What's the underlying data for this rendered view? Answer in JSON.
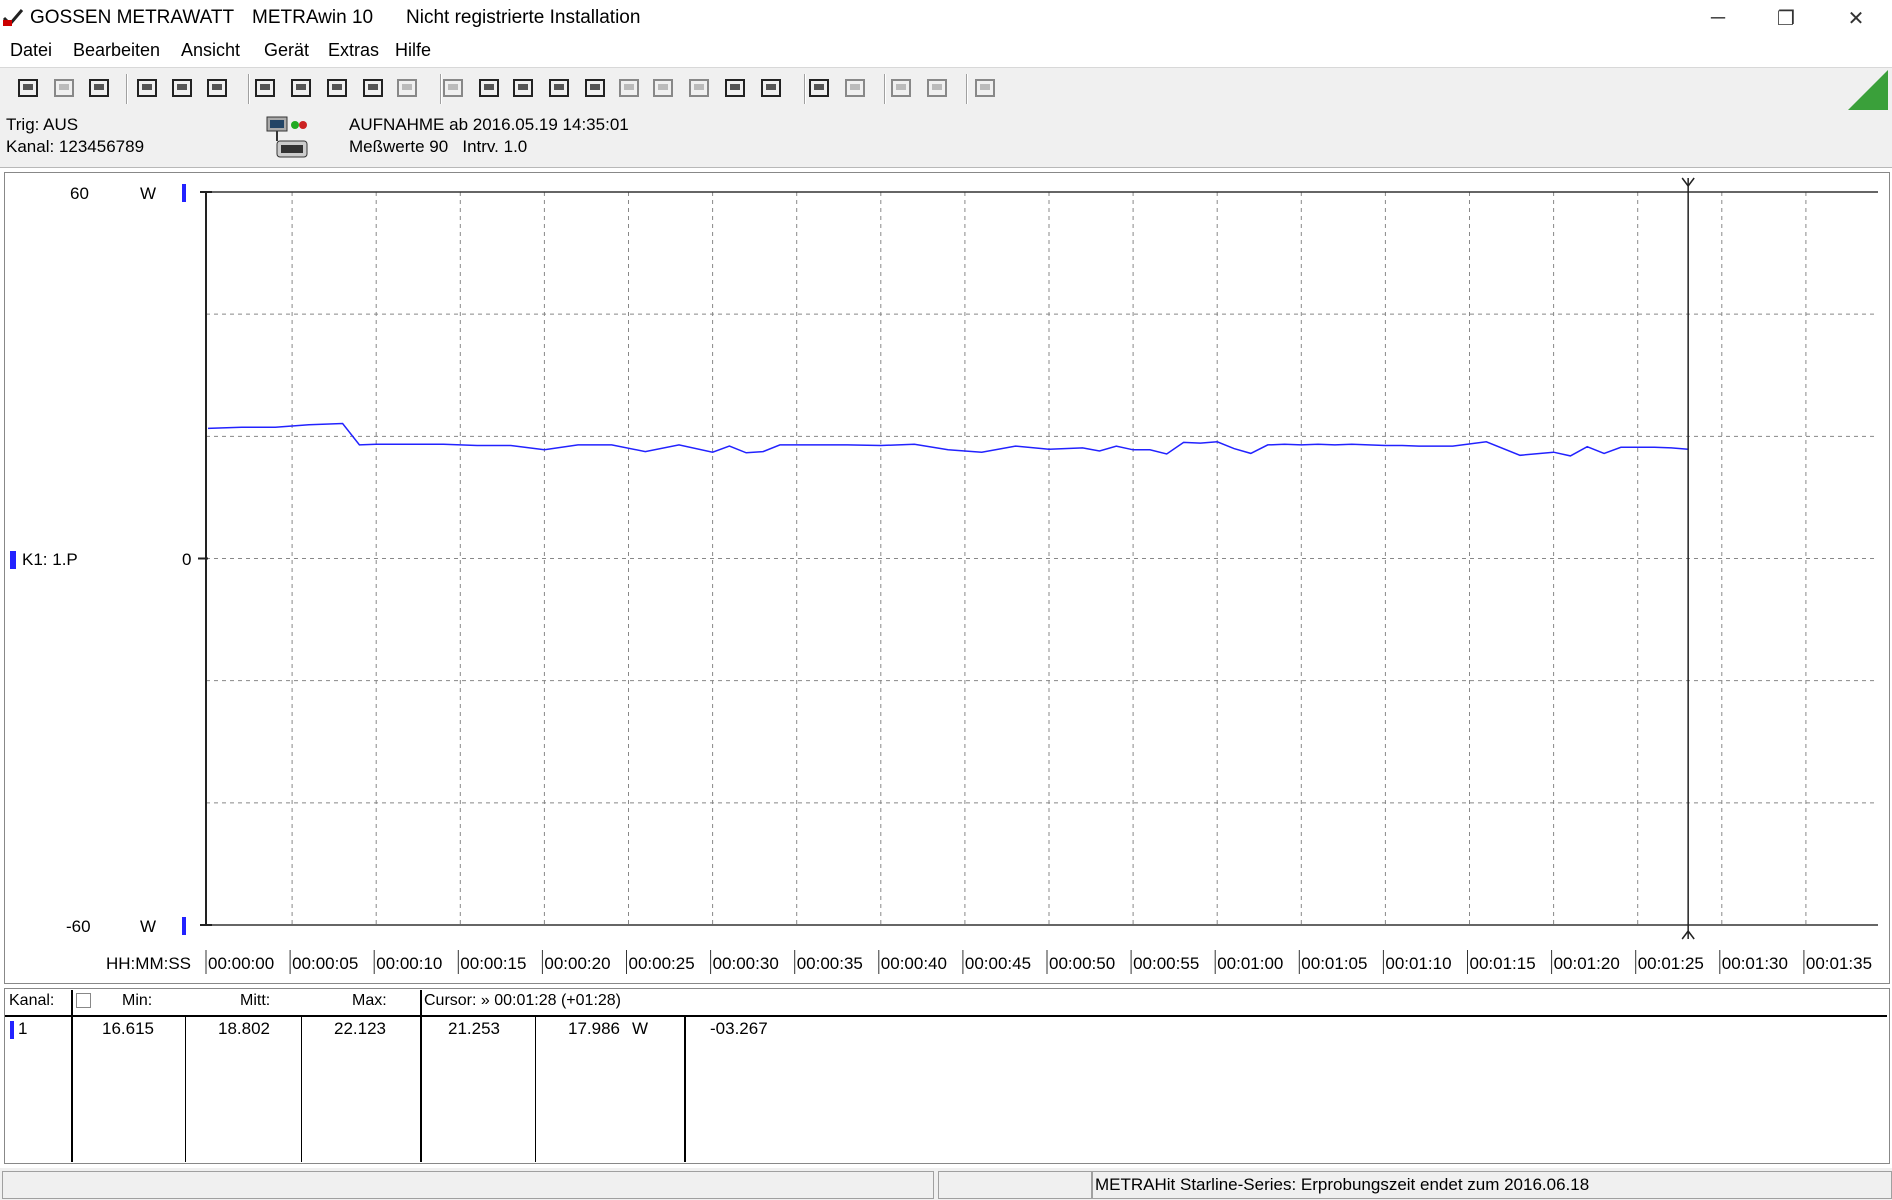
{
  "window": {
    "brand": "GOSSEN METRAWATT",
    "app": "METRAwin 10",
    "subtitle": "Nicht registrierte Installation",
    "minimize": "─",
    "restore": "❐",
    "close": "✕"
  },
  "menu": [
    "Datei",
    "Bearbeiten",
    "Ansicht",
    "Gerät",
    "Extras",
    "Hilfe"
  ],
  "toolbar": {
    "icons": [
      "save-icon",
      "save-disabled-icon",
      "open-icon",
      "device-read-icon",
      "device-record-icon",
      "device-stop-icon",
      "display-icon",
      "scope-icon",
      "cursor-icon",
      "table-icon",
      "bars-icon",
      "export-icon",
      "print-preview-icon",
      "settings-icon",
      "monitor-icon",
      "formula-icon",
      "calc-icon",
      "wave-icon",
      "wave2-icon",
      "find-icon",
      "clock-icon",
      "print-icon",
      "print2-icon",
      "zoom-in-icon",
      "zoom-out-icon",
      "comment-icon"
    ],
    "accent": "#3aa03a"
  },
  "info": {
    "trig": "Trig: AUS",
    "kanal": "Kanal: 123456789",
    "aufnahme": "AUFNAHME ab 2016.05.19 14:35:01",
    "messwerte": "Meßwerte 90   Intrv. 1.0"
  },
  "chart_data": {
    "type": "line",
    "y_top_label": "60",
    "y_bottom_label": "-60",
    "y_unit": "W",
    "y_zero_label": "0",
    "ylim": [
      -60,
      60
    ],
    "channel_label": "K1: 1.P",
    "x_axis_label": "HH:MM:SS",
    "x_ticks": [
      "00:00:00",
      "00:00:05",
      "00:00:10",
      "00:00:15",
      "00:00:20",
      "00:00:25",
      "00:00:30",
      "00:00:35",
      "00:00:40",
      "00:00:45",
      "00:00:50",
      "00:00:55",
      "00:01:00",
      "00:01:05",
      "00:01:10",
      "00:01:15",
      "00:01:20",
      "00:01:25",
      "00:01:30",
      "00:01:35"
    ],
    "xlim": [
      0,
      99.5
    ],
    "cursor_x": 88,
    "series": [
      {
        "color": "#2222ff",
        "x": [
          0,
          2,
          4,
          6,
          8,
          9,
          10,
          11,
          12,
          14,
          16,
          18,
          20,
          22,
          24,
          26,
          28,
          30,
          31,
          32,
          33,
          34,
          35,
          36,
          37,
          38,
          40,
          42,
          44,
          46,
          48,
          50,
          52,
          53,
          54,
          55,
          56,
          57,
          58,
          59,
          60,
          61,
          62,
          63,
          64,
          65,
          66,
          67,
          68,
          69,
          70,
          71,
          72,
          74,
          76,
          78,
          80,
          81,
          82,
          83,
          84,
          85,
          86,
          87,
          88
        ],
        "y": [
          21.3,
          21.5,
          21.5,
          21.9,
          22.1,
          18.6,
          18.7,
          18.7,
          18.7,
          18.7,
          18.5,
          18.5,
          17.8,
          18.6,
          18.6,
          17.5,
          18.6,
          17.4,
          18.4,
          17.3,
          17.5,
          18.6,
          18.6,
          18.6,
          18.6,
          18.6,
          18.5,
          18.7,
          17.8,
          17.4,
          18.4,
          17.9,
          18.1,
          17.6,
          18.4,
          17.8,
          17.8,
          17.1,
          19.0,
          18.9,
          19.1,
          18.0,
          17.2,
          18.6,
          18.7,
          18.6,
          18.7,
          18.6,
          18.7,
          18.6,
          18.5,
          18.5,
          18.4,
          18.4,
          19.1,
          16.9,
          17.4,
          16.8,
          18.3,
          17.2,
          18.2,
          18.2,
          18.2,
          18.1,
          17.9
        ]
      }
    ]
  },
  "table": {
    "headers": {
      "kanal": "Kanal:",
      "min": "Min:",
      "mitt": "Mitt:",
      "max": "Max:",
      "cursor": "Cursor: » 00:01:28 (+01:28)"
    },
    "row": {
      "kanal": "1",
      "min": "16.615",
      "mitt": "18.802",
      "max": "22.123",
      "cur1": "21.253",
      "cur2": "17.986",
      "unit": "W",
      "diff": "-03.267"
    }
  },
  "status": {
    "message": "METRAHit Starline-Series: Erprobungszeit endet zum  2016.06.18"
  }
}
